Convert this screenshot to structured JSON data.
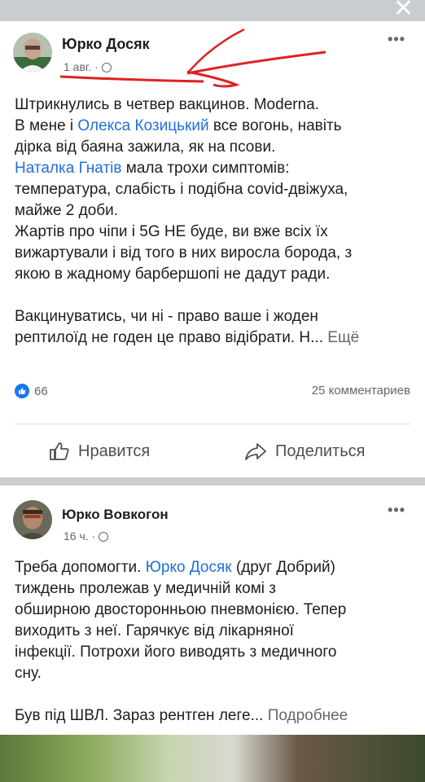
{
  "window": {
    "close_symbol": "✕"
  },
  "post1": {
    "author": "Юрко Досяк",
    "date": "1 авг. · ",
    "more": "•••",
    "lines": [
      {
        "t": "Штрикнулись в четвер вакцинов. Moderna."
      },
      {
        "a": "В мене і ",
        "link": "Олекса Козицький",
        "b": " все вогонь, навіть"
      },
      {
        "t": "дірка від баяна зажила, як на псови."
      },
      {
        "link": "Наталка Гнатів",
        "b": " мала трохи симптомів:"
      },
      {
        "t": "температура, слабість і подібна covid-двіжуха,"
      },
      {
        "t": "майже 2 доби."
      },
      {
        "t": "Жартів про чіпи і 5G НЕ буде, ви вже всіх їх"
      },
      {
        "t": "вижартували і від того в них виросла борода, з"
      },
      {
        "t": "якою в жадному барбершопі не дадут ради."
      },
      {
        "t": ""
      },
      {
        "t": "Вакцинуватись, чи ні - право ваше і жоден"
      },
      {
        "a": "рептилоїд не годен це право відібрати. Н... ",
        "more": "Ещё"
      }
    ],
    "reactions_count": "66",
    "comments_count": "25 комментариев",
    "like_label": "Нравится",
    "share_label": "Поделиться"
  },
  "post2": {
    "author": "Юрко Вовкогон",
    "date": "16 ч. · ",
    "more": "•••",
    "lines": [
      {
        "a": "Треба допомогти. ",
        "link": "Юрко Досяк",
        "b": " (друг Добрий)"
      },
      {
        "t": "тиждень пролежав у медичній комі з"
      },
      {
        "t": "обширною двосторонньою пневмонією. Тепер"
      },
      {
        "t": "виходить з неї.  Гарячкує від лікарняної"
      },
      {
        "t": "інфекції. Потрохи його виводять з медичного"
      },
      {
        "t": "сну."
      },
      {
        "t": ""
      },
      {
        "a": "Був під ШВЛ. Зараз рентген леге... ",
        "more": "Подробнее"
      }
    ]
  },
  "colors": {
    "link": "#216fdb",
    "annotation": "#e02020",
    "like_blue": "#1877f2"
  }
}
